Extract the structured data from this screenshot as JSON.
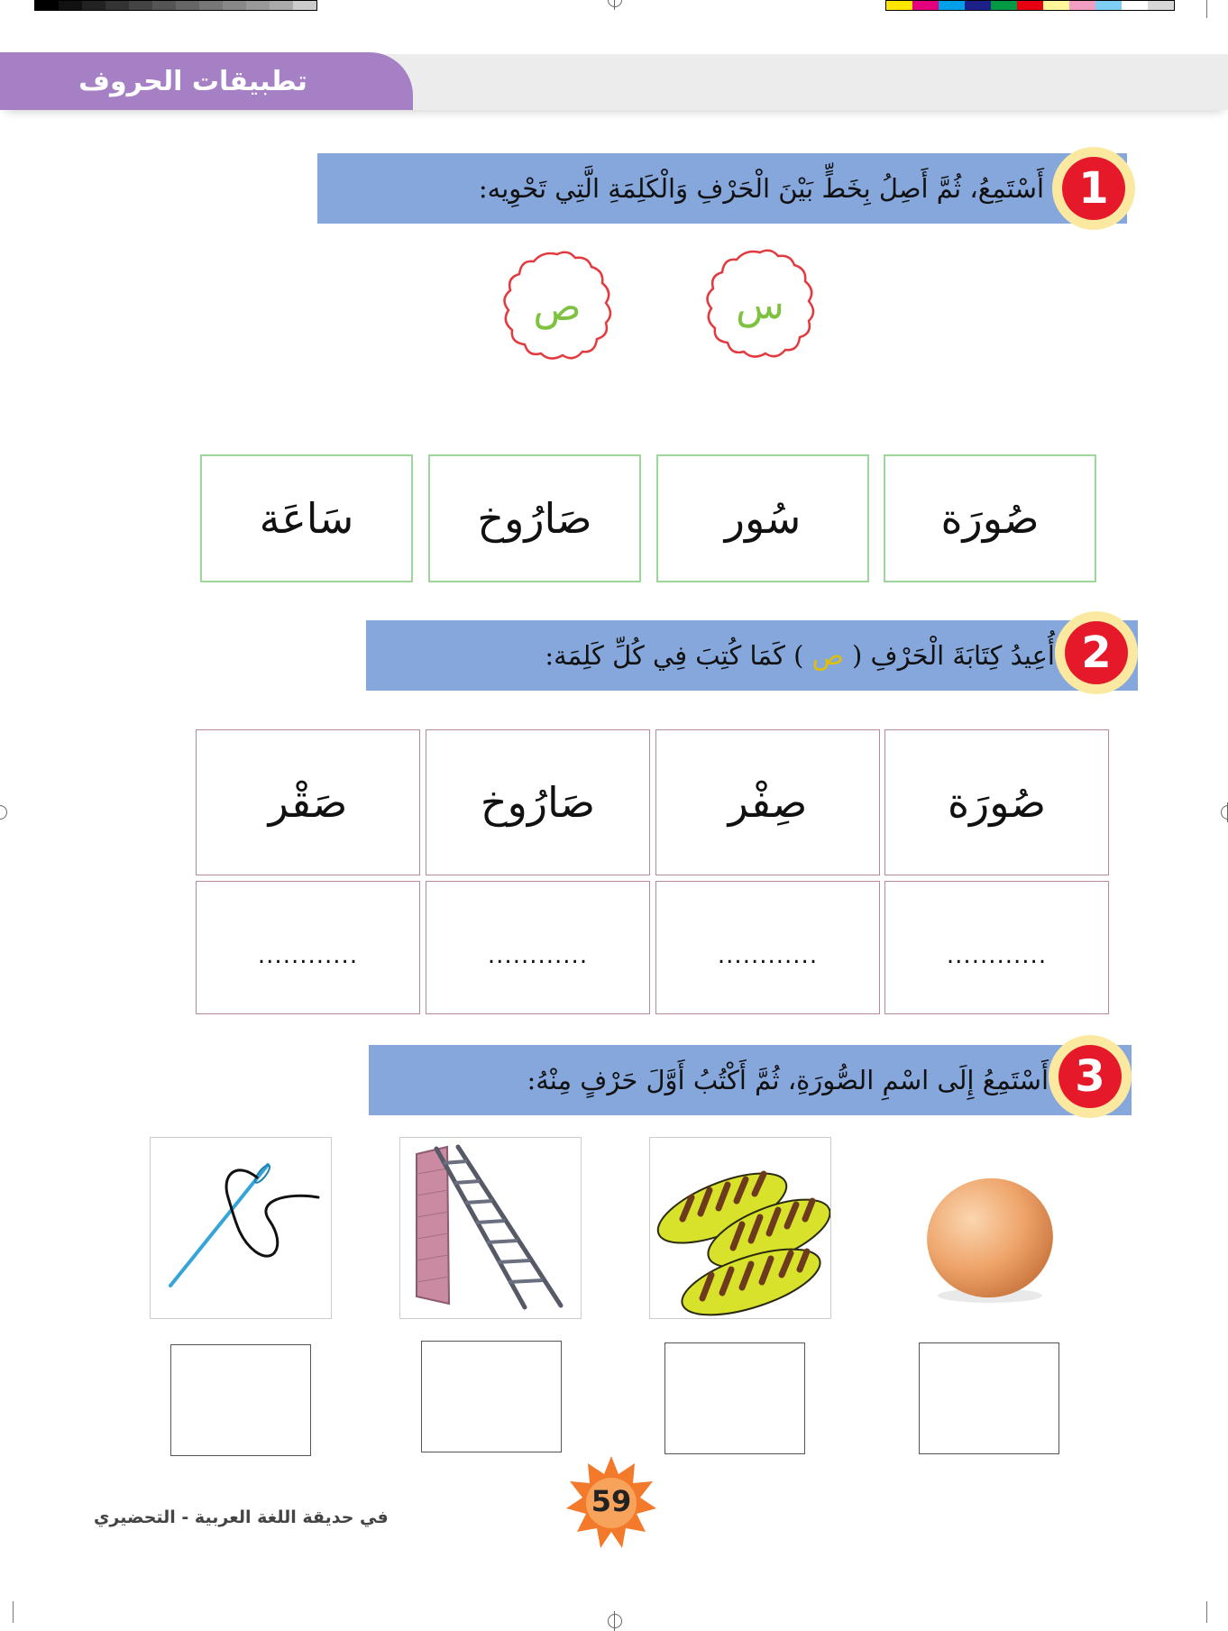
{
  "header": {
    "title": "تطبيقات الحروف"
  },
  "colors": {
    "header_tab": "#a580c4",
    "instruction_bar": "#86a7dc",
    "badge_red": "#e6192b",
    "badge_ring": "#fbe9a2",
    "letter_green": "#7fc241",
    "wavy_border": "#e23a3f",
    "word_box_border": "#9ed59a",
    "copy_box_border": "#b8889c",
    "page_star": "#f27a2a"
  },
  "exercise1": {
    "number": "1",
    "instruction": "أَسْتَمِعُ، ثُمَّ أَصِلُ بِخَطٍّ بَيْنَ الْحَرْفِ وَالْكَلِمَةِ الَّتِي تَحْوِيه:",
    "letters": [
      "س",
      "ص"
    ],
    "words": [
      "صُورَة",
      "سُور",
      "صَارُوخ",
      "سَاعَة"
    ]
  },
  "exercise2": {
    "number": "2",
    "instruction_before": "أُعِيدُ كِتَابَةَ الْحَرْفِ (",
    "instruction_letter": "ص",
    "instruction_after": ") كَمَا كُتِبَ فِي كُلِّ كَلِمَة:",
    "words": [
      "صُورَة",
      "صِفْر",
      "صَارُوخ",
      "صَقْر"
    ],
    "blank": "............"
  },
  "exercise3": {
    "number": "3",
    "instruction": "أَسْتَمِعُ إِلَى اسْمِ الصُّورَةِ، ثُمَّ أَكْتُبُ أَوَّلَ حَرْفٍ مِنْهُ:",
    "pictures": [
      "egg-icon",
      "bread-icon",
      "ladder-icon",
      "needle-icon"
    ]
  },
  "footer": {
    "page_number": "59",
    "book_title": "في حديقة اللغة العربية - التحضيري"
  }
}
